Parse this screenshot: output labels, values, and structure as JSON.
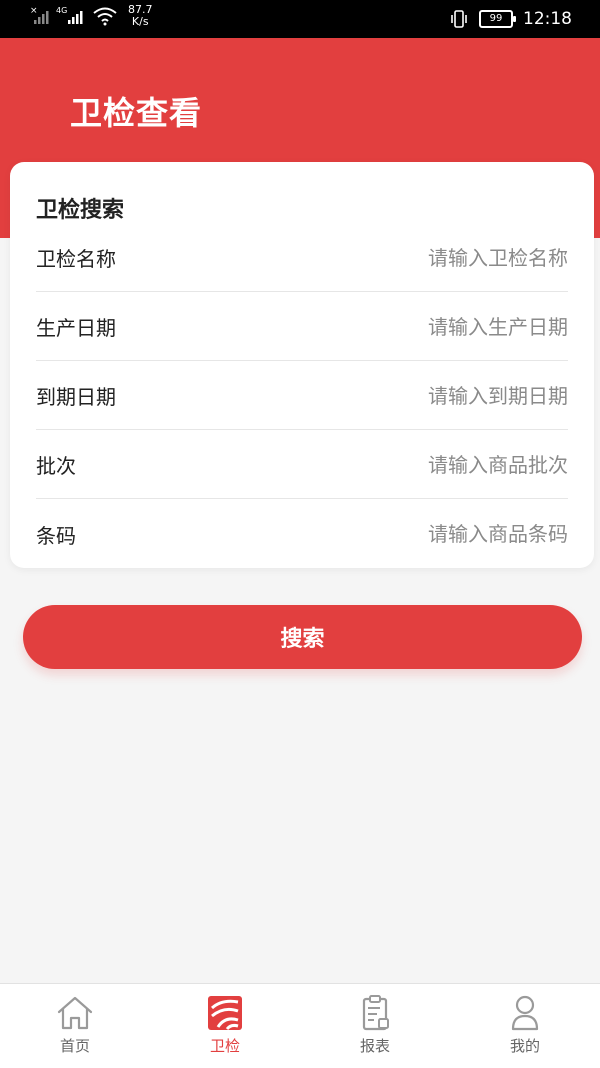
{
  "status_bar": {
    "network_type": "4G",
    "net_speed_value": "87.7",
    "net_speed_unit": "K/s",
    "battery": "99",
    "time": "12:18"
  },
  "header": {
    "title": "卫检查看"
  },
  "search_card": {
    "title": "卫检搜索",
    "fields": [
      {
        "label": "卫检名称",
        "placeholder": "请输入卫检名称",
        "value": ""
      },
      {
        "label": "生产日期",
        "placeholder": "请输入生产日期",
        "value": ""
      },
      {
        "label": "到期日期",
        "placeholder": "请输入到期日期",
        "value": ""
      },
      {
        "label": "批次",
        "placeholder": "请输入商品批次",
        "value": ""
      },
      {
        "label": "条码",
        "placeholder": "请输入商品条码",
        "value": ""
      }
    ]
  },
  "search_button": {
    "label": "搜索"
  },
  "tab_bar": {
    "items": [
      {
        "label": "首页",
        "icon": "home-icon",
        "active": false
      },
      {
        "label": "卫检",
        "icon": "inspection-icon",
        "active": true
      },
      {
        "label": "报表",
        "icon": "report-icon",
        "active": false
      },
      {
        "label": "我的",
        "icon": "profile-icon",
        "active": false
      }
    ]
  },
  "colors": {
    "accent": "#e23f3f",
    "background": "#f5f5f5",
    "inactive_tab": "#666666"
  }
}
